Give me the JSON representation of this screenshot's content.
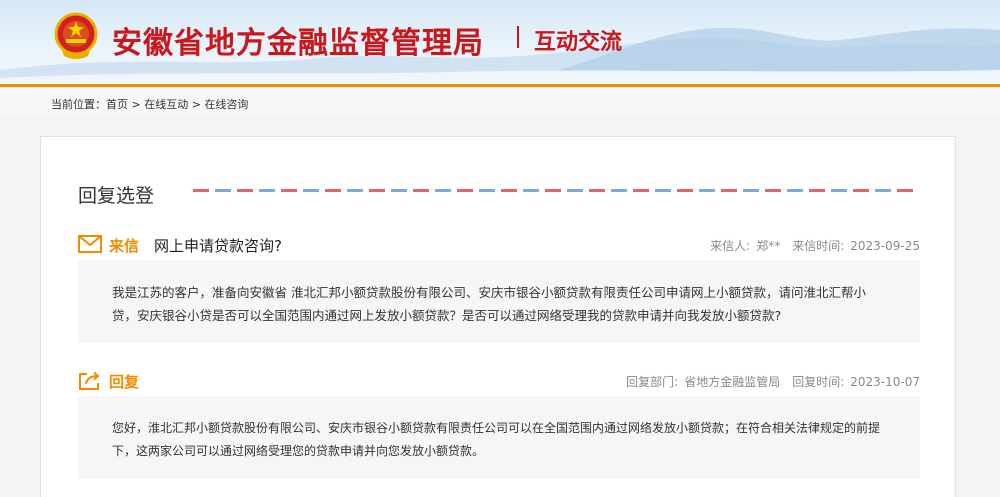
{
  "header": {
    "site_title": "安徽省地方金融监督管理局",
    "section_title": "互动交流",
    "colors": {
      "brand_red": "#c9171e",
      "accent_orange": "#f08c00"
    }
  },
  "breadcrumb": {
    "prefix": "当前位置：",
    "items": [
      "首页",
      "在线互动",
      "在线咨询"
    ],
    "separator": " > "
  },
  "content": {
    "heading": "回复选登",
    "letter": {
      "type_label": "来信",
      "icon": "envelope-icon",
      "subject": "网上申请贷款咨询?",
      "sender_label": "来信人:",
      "sender": "郑**",
      "date_label": "来信时间:",
      "date": "2023-09-25",
      "body": "我是江苏的客户，准备向安徽省 淮北汇邦小额贷款股份有限公司、安庆市银谷小额贷款有限责任公司申请网上小额贷款，请问淮北汇帮小贷，安庆银谷小贷是否可以全国范围内通过网上发放小额贷款？是否可以通过网络受理我的贷款申请并向我发放小额贷款?"
    },
    "reply": {
      "type_label": "回复",
      "icon": "reply-share-icon",
      "dept_label": "回复部门:",
      "dept": "省地方金融监管局",
      "date_label": "回复时间:",
      "date": "2023-10-07",
      "body": "您好，淮北汇邦小额贷款股份有限公司、安庆市银谷小额贷款有限责任公司可以在全国范围内通过网络发放小额贷款；在符合相关法律规定的前提下，这两家公司可以通过网络受理您的贷款申请并向您发放小额贷款。"
    }
  }
}
